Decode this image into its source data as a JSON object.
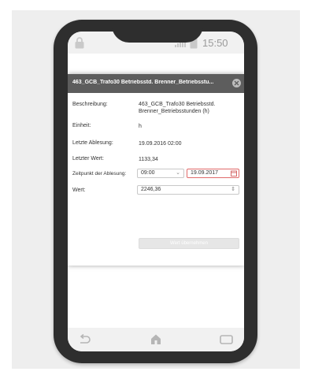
{
  "status_bar": {
    "time": "15:50"
  },
  "dialog": {
    "title": "463_GCB_Trafo30 Betriebsstd. Brenner_Betriebsstu...",
    "fields": {
      "beschreibung": {
        "label": "Beschreibung:",
        "value_line1": "463_GCB_Trafo30 Betriebsstd.",
        "value_line2": "Brenner_Betriebsstunden (h)"
      },
      "einheit": {
        "label": "Einheit:",
        "value": "h"
      },
      "letzte_ablesung": {
        "label": "Letzte Ablesung:",
        "value": "19.09.2016 02:00"
      },
      "letzter_wert": {
        "label": "Letzter Wert:",
        "value": "1133,34"
      },
      "zeitpunkt": {
        "label": "Zeitpunkt der Ablesung:",
        "time_value": "09:00",
        "date_value": "19.09.2017"
      },
      "wert": {
        "label": "Wert:",
        "value": "2246,36"
      }
    },
    "submit_label": "Wert übernehmen"
  }
}
